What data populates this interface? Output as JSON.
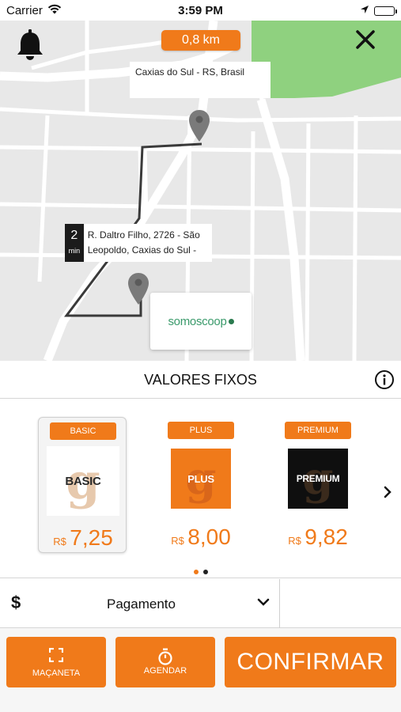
{
  "status_bar": {
    "carrier": "Carrier",
    "time": "3:59 PM"
  },
  "map": {
    "distance": "0,8 km",
    "destination_label": "Caxias do Sul - RS, Brasil",
    "eta_value": "2",
    "eta_unit": "min",
    "origin_address": "R. Daltro Filho, 2726 - São Leopoldo, Caxias do Sul -",
    "partner_logo_text": "somoscoop",
    "colors": {
      "park": "#8fd17f",
      "roads": "#ffffff",
      "land": "#e8e8e8",
      "route": "#3a3a3a"
    }
  },
  "sheet": {
    "title": "VALORES FIXOS"
  },
  "cards": [
    {
      "badge": "BASIC",
      "image_label": "BASIC",
      "currency": "R$",
      "price": "7,25",
      "selected": true
    },
    {
      "badge": "PLUS",
      "image_label": "PLUS",
      "currency": "R$",
      "price": "8,00",
      "selected": false
    },
    {
      "badge": "PREMIUM",
      "image_label": "PREMIUM",
      "currency": "R$",
      "price": "9,82",
      "selected": false
    }
  ],
  "pager": {
    "pages": 2,
    "active": 1
  },
  "payment": {
    "icon": "$",
    "label": "Pagamento"
  },
  "actions": {
    "door_handle": "MAÇANETA",
    "schedule": "AGENDAR",
    "confirm": "CONFIRMAR"
  },
  "accent_color": "#f07a1a"
}
